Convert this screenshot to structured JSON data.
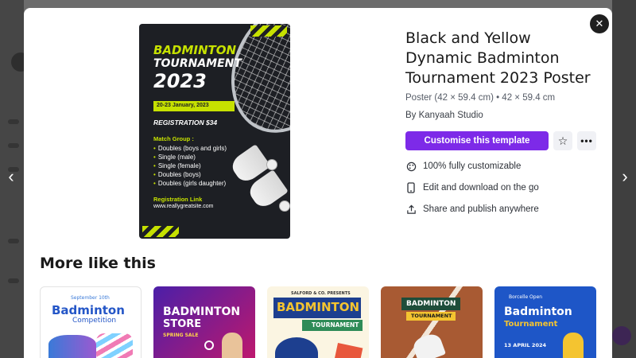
{
  "template": {
    "title": "Black and Yellow Dynamic Badminton Tournament 2023 Poster",
    "subtitle": "Poster (42 × 59.4 cm) • 42 × 59.4 cm",
    "author": "By Kanyaah Studio",
    "cta_label": "Customise this template",
    "more_label": "•••",
    "features": [
      {
        "icon": "palette-icon",
        "label": "100% fully customizable"
      },
      {
        "icon": "phone-icon",
        "label": "Edit and download on the go"
      },
      {
        "icon": "share-icon",
        "label": "Share and publish anywhere"
      }
    ]
  },
  "poster": {
    "line1": "BADMINTON",
    "line2": "TOURNAMENT",
    "year": "2023",
    "date": "20-23 January, 2023",
    "registration": "REGISTRATION $34",
    "match_group": "Match Group :",
    "groups": [
      "Doubles (boys and girls)",
      "Single (male)",
      "Single (female)",
      "Doubles (boys)",
      "Doubles (girls daughter)"
    ],
    "reg_link": "Registration Link",
    "site": "www.reallygreatsite.com"
  },
  "more_like_this": {
    "heading": "More like this",
    "items": [
      {
        "date": "September 10th",
        "title": "Badminton",
        "sub": "Competition"
      },
      {
        "title": "BADMINTON",
        "sub": "STORE",
        "tag": "SPRING SALE"
      },
      {
        "top": "SALFORD & CO. PRESENTS",
        "title": "BADMINTON",
        "sub": "TOURNAMENT"
      },
      {
        "title": "BADMINTON",
        "sub": "TOURNAMENT"
      },
      {
        "top": "Borcelle Open",
        "title": "Badminton",
        "sub": "Tournament",
        "date": "13 APRIL 2024"
      }
    ]
  },
  "colors": {
    "accent": "#7d2ae8",
    "poster_yellow": "#c6e100",
    "poster_dark": "#1d1f24"
  }
}
